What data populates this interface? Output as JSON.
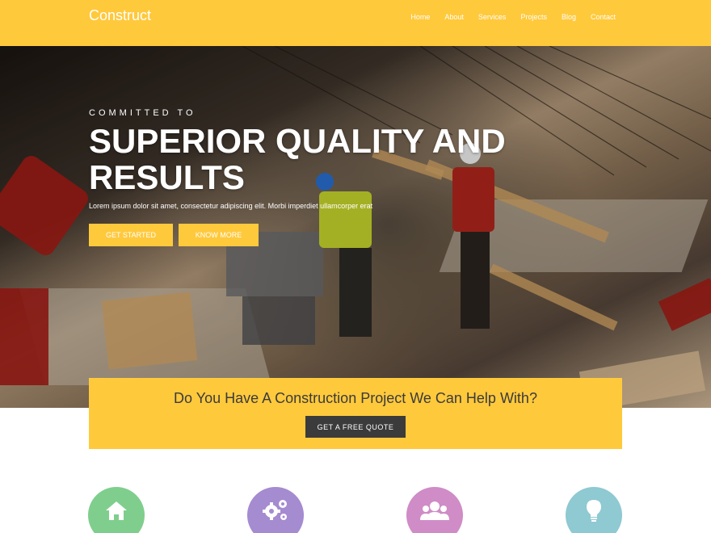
{
  "header": {
    "brand": "Construct",
    "nav": [
      "Home",
      "About",
      "Services",
      "Projects",
      "Blog",
      "Contact"
    ]
  },
  "hero": {
    "eyebrow": "COMMITTED TO",
    "headline_line1": "SUPERIOR QUALITY AND",
    "headline_line2": "RESULTS",
    "subtext": "Lorem ipsum dolor sit amet, consectetur adipiscing elit. Morbi imperdiet ullamcorper erat",
    "buttons": {
      "primary": "GET STARTED",
      "secondary": "KNOW MORE"
    }
  },
  "quote": {
    "title": "Do You Have A Construction Project We Can Help With?",
    "button": "GET A FREE QUOTE"
  },
  "features": [
    {
      "icon": "home-icon",
      "color": "#7fce8d"
    },
    {
      "icon": "gears-icon",
      "color": "#a58bd0"
    },
    {
      "icon": "users-icon",
      "color": "#cf8cc6"
    },
    {
      "icon": "lightbulb-icon",
      "color": "#8fc9d2"
    }
  ],
  "colors": {
    "accent": "#ffc93c",
    "dark_button": "#3b3b3b",
    "white": "#ffffff"
  }
}
